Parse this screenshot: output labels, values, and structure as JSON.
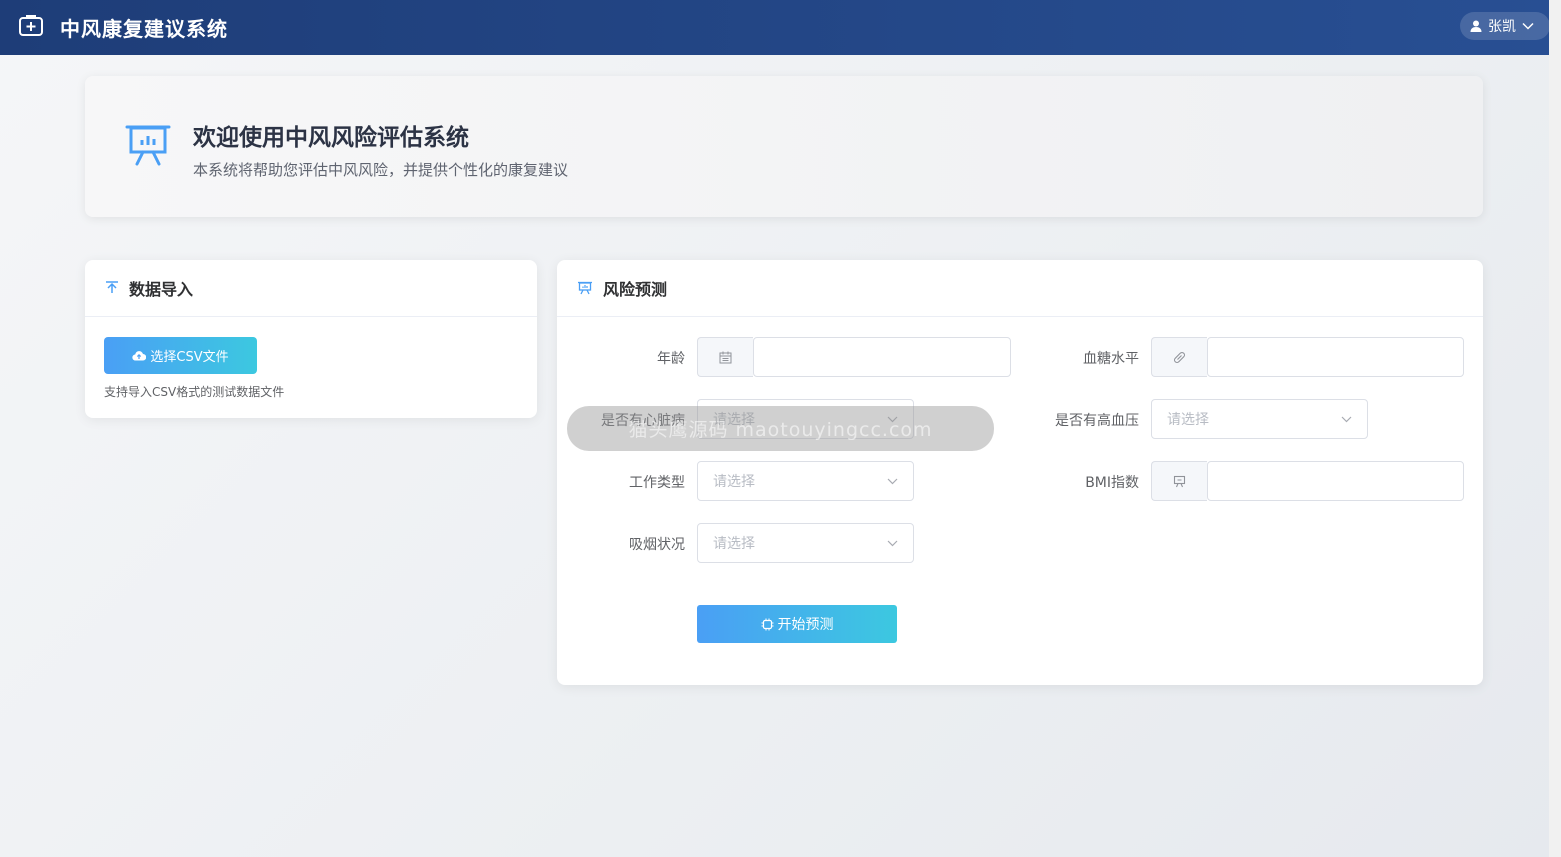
{
  "header": {
    "app_title": "中风康复建议系统",
    "user_name": "张凯",
    "logo_icon": "medical-kit-icon"
  },
  "welcome": {
    "title": "欢迎使用中风风险评估系统",
    "subtitle": "本系统将帮助您评估中风风险，并提供个性化的康复建议",
    "icon": "presentation-chart-icon"
  },
  "import_card": {
    "title": "数据导入",
    "button_label": "选择CSV文件",
    "hint": "支持导入CSV格式的测试数据文件"
  },
  "predict_card": {
    "title": "风险预测",
    "fields": {
      "age": {
        "label": "年龄",
        "value": ""
      },
      "glucose": {
        "label": "血糖水平",
        "value": ""
      },
      "heart_disease": {
        "label": "是否有心脏病",
        "placeholder": "请选择"
      },
      "hypertension": {
        "label": "是否有高血压",
        "placeholder": "请选择"
      },
      "work_type": {
        "label": "工作类型",
        "placeholder": "请选择"
      },
      "bmi": {
        "label": "BMI指数",
        "value": ""
      },
      "smoking": {
        "label": "吸烟状况",
        "placeholder": "请选择"
      }
    },
    "submit_label": "开始预测"
  },
  "watermark": "猫头鹰源码 maotouyingcc.com",
  "colors": {
    "header_start": "#1e3d78",
    "header_end": "#284f93",
    "accent_start": "#4a9ff5",
    "accent_end": "#3cc8e0"
  }
}
